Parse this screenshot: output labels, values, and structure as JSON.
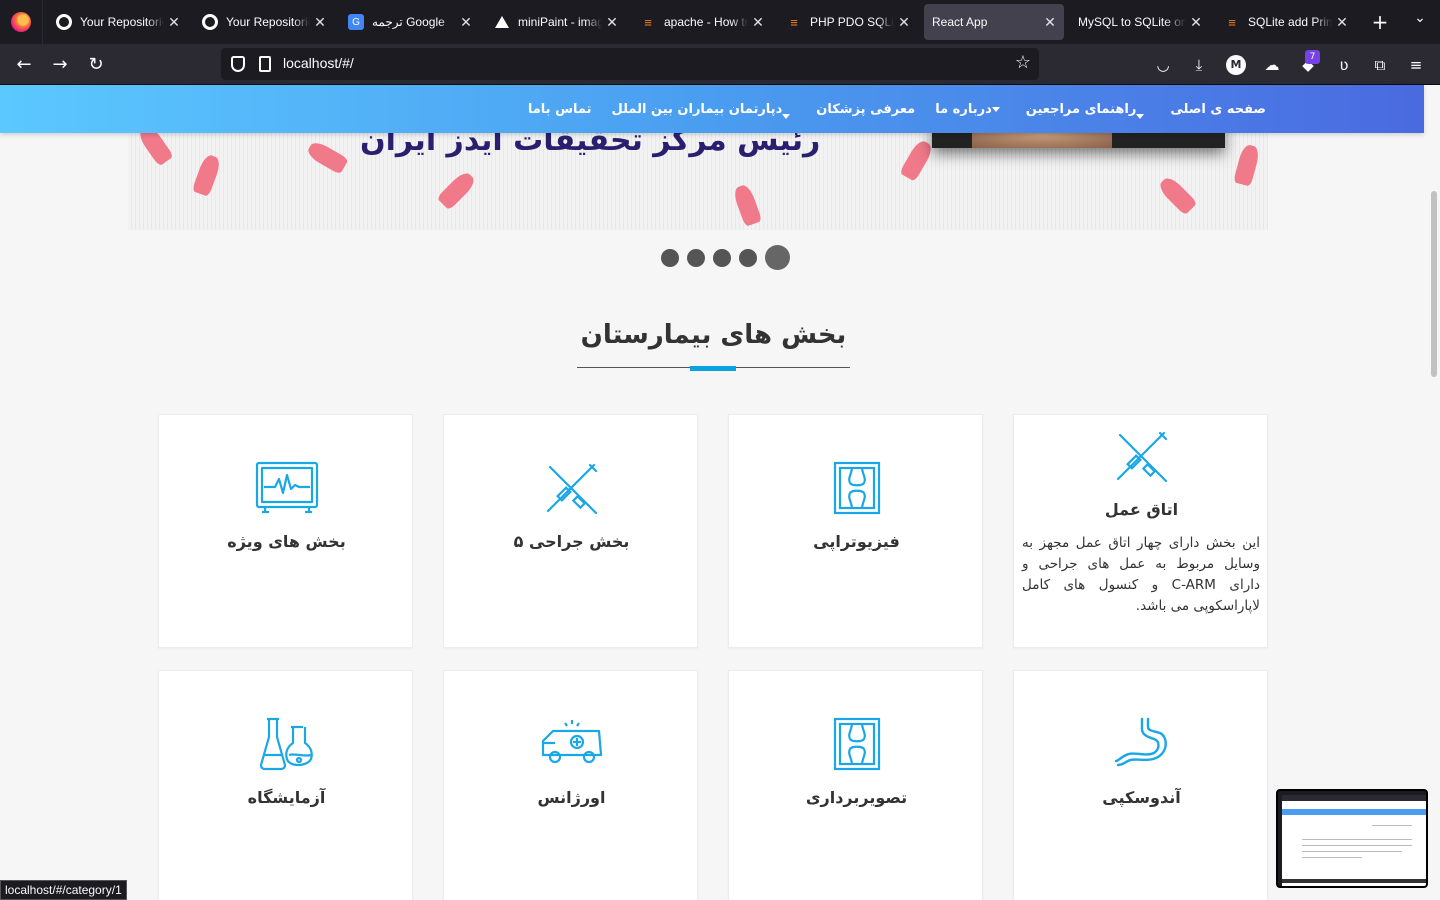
{
  "browser": {
    "tabs": [
      {
        "title": "Your Repositories",
        "favicon": "github-icon"
      },
      {
        "title": "Your Repositories",
        "favicon": "github-icon"
      },
      {
        "title": "ترجمه Google",
        "favicon": "google-translate-icon"
      },
      {
        "title": "miniPaint - image editor",
        "favicon": "minipaint-icon"
      },
      {
        "title": "apache - How to",
        "favicon": "stackoverflow-icon"
      },
      {
        "title": "PHP PDO SQLite",
        "favicon": "stackoverflow-icon"
      },
      {
        "title": "React App",
        "favicon": "none",
        "active": true
      },
      {
        "title": "MySQL to SQLite online",
        "favicon": "none"
      },
      {
        "title": "SQLite add Primary",
        "favicon": "stackoverflow-icon"
      }
    ],
    "url": "localhost/#/",
    "extension_badge": "7",
    "account_letter": "M",
    "status_url": "localhost/#/category/1"
  },
  "site": {
    "nav": {
      "home": "صفحه ی اصلی",
      "guide": "راهنمای مراجعین",
      "about": "درباره ما",
      "doctors": "معرفی پزشکان",
      "international": "دپارتمان بیماران بین الملل",
      "contact": "تماس باما"
    },
    "hero_text": "رئیس مرکز تحقیقات ایدز ایران",
    "slider": {
      "total": 5,
      "active_index": 0
    },
    "section_title": "بخش های بیمارستان",
    "departments": [
      {
        "title": "اتاق عمل",
        "icon": "surgery-tools-icon",
        "description": "این بخش دارای چهار اتاق عمل مجهز به وسایل مربوط به عمل های جراحی و دارای C-ARM و کنسول های کامل لاپاراسکوپی می باشد."
      },
      {
        "title": "فیزیوتراپی",
        "icon": "xray-joint-icon"
      },
      {
        "title": "بخش جراحی ۵",
        "icon": "surgery-tools-icon"
      },
      {
        "title": "بخش های ویژه",
        "icon": "heart-monitor-icon"
      },
      {
        "title": "آندوسکپی",
        "icon": "stomach-icon"
      },
      {
        "title": "تصویربرداری",
        "icon": "xray-joint-icon"
      },
      {
        "title": "اورژانس",
        "icon": "ambulance-icon"
      },
      {
        "title": "آزمایشگاه",
        "icon": "lab-flask-icon"
      }
    ]
  },
  "colors": {
    "accent": "#0aa3e0",
    "icon_blue": "#1aa7e6",
    "nav_gradient_start": "#5bc8ff",
    "nav_gradient_end": "#4a6ae0"
  }
}
